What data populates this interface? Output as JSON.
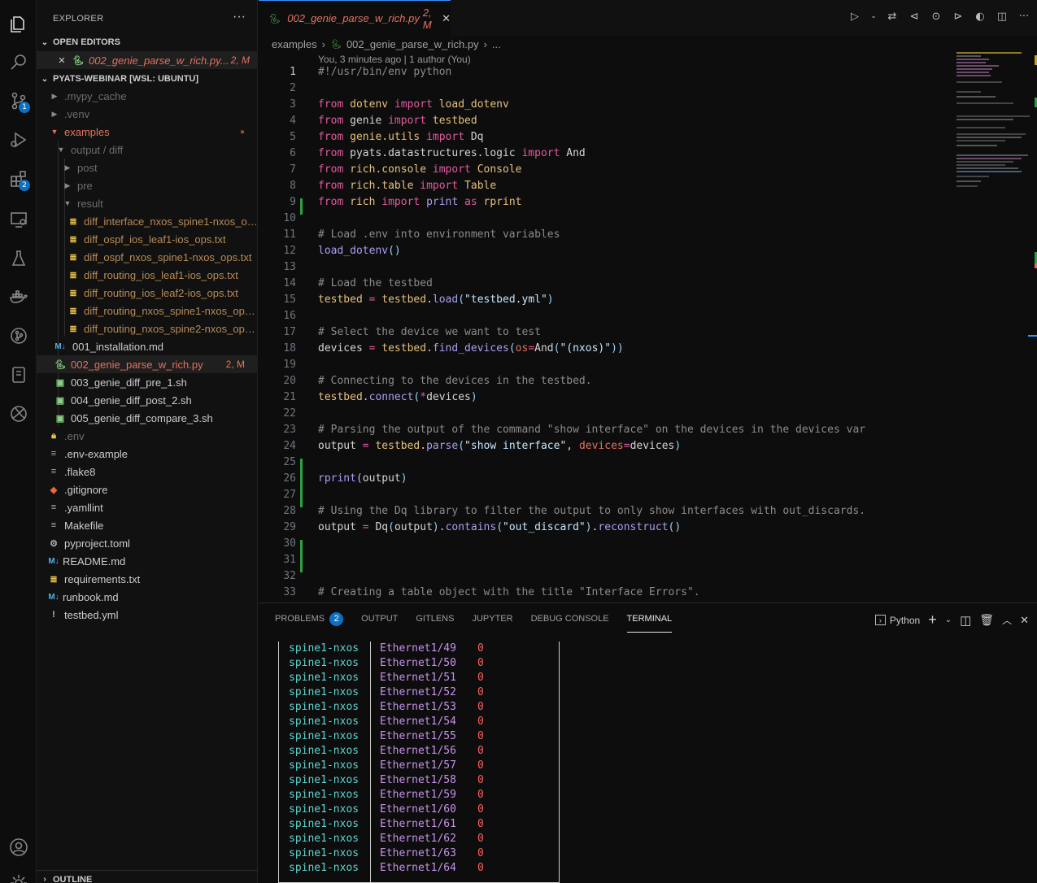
{
  "activity_bar": [
    {
      "icon": "files-icon",
      "badge": ""
    },
    {
      "icon": "search-icon",
      "badge": ""
    },
    {
      "icon": "source-control-icon",
      "badge": "1"
    },
    {
      "icon": "run-debug-icon",
      "badge": ""
    },
    {
      "icon": "extensions-icon",
      "badge": "2"
    },
    {
      "icon": "remote-explorer-icon",
      "badge": ""
    },
    {
      "icon": "testing-icon",
      "badge": ""
    },
    {
      "icon": "docker-icon",
      "badge": ""
    },
    {
      "icon": "gitlens-icon",
      "badge": ""
    },
    {
      "icon": "jupyter-icon",
      "badge": ""
    },
    {
      "icon": "browser-icon",
      "badge": ""
    },
    {
      "icon": "accounts-icon",
      "badge": ""
    },
    {
      "icon": "manage-gear-icon",
      "badge": ""
    }
  ],
  "sidebar": {
    "title": "EXPLORER",
    "more": "···",
    "open_editors_label": "OPEN EDITORS",
    "open_editor": {
      "name": "002_genie_parse_w_rich.py...",
      "status": "2, M"
    },
    "workspace_label": "PYATS-WEBINAR [WSL: UBUNTU]",
    "tree": [
      {
        "name": ".mypy_cache",
        "status": ""
      },
      {
        "name": ".venv",
        "status": ""
      },
      {
        "name": "examples",
        "status": "●"
      },
      {
        "name": "output / diff",
        "status": ""
      },
      {
        "name": "post",
        "status": ""
      },
      {
        "name": "pre",
        "status": ""
      },
      {
        "name": "result",
        "status": ""
      },
      {
        "name": "diff_interface_nxos_spine1-nxos_op...",
        "status": ""
      },
      {
        "name": "diff_ospf_ios_leaf1-ios_ops.txt",
        "status": ""
      },
      {
        "name": "diff_ospf_nxos_spine1-nxos_ops.txt",
        "status": ""
      },
      {
        "name": "diff_routing_ios_leaf1-ios_ops.txt",
        "status": ""
      },
      {
        "name": "diff_routing_ios_leaf2-ios_ops.txt",
        "status": ""
      },
      {
        "name": "diff_routing_nxos_spine1-nxos_ops...",
        "status": ""
      },
      {
        "name": "diff_routing_nxos_spine2-nxos_ops...",
        "status": ""
      },
      {
        "name": "001_installation.md",
        "status": ""
      },
      {
        "name": "002_genie_parse_w_rich.py",
        "status": "2, M"
      },
      {
        "name": "003_genie_diff_pre_1.sh",
        "status": ""
      },
      {
        "name": "004_genie_diff_post_2.sh",
        "status": ""
      },
      {
        "name": "005_genie_diff_compare_3.sh",
        "status": ""
      },
      {
        "name": ".env",
        "status": ""
      },
      {
        "name": ".env-example",
        "status": ""
      },
      {
        "name": ".flake8",
        "status": ""
      },
      {
        "name": ".gitignore",
        "status": ""
      },
      {
        "name": ".yamllint",
        "status": ""
      },
      {
        "name": "Makefile",
        "status": ""
      },
      {
        "name": "pyproject.toml",
        "status": ""
      },
      {
        "name": "README.md",
        "status": ""
      },
      {
        "name": "requirements.txt",
        "status": ""
      },
      {
        "name": "runbook.md",
        "status": ""
      },
      {
        "name": "testbed.yml",
        "status": ""
      }
    ],
    "outline_label": "OUTLINE"
  },
  "editor": {
    "tab_name": "002_genie_parse_w_rich.py",
    "tab_status": "2, M",
    "breadcrumb": [
      "examples",
      "002_genie_parse_w_rich.py",
      "..."
    ],
    "blame": "You, 3 minutes ago | 1 author (You)",
    "line_numbers": [
      "1",
      "2",
      "3",
      "4",
      "5",
      "6",
      "7",
      "8",
      "9",
      "10",
      "11",
      "12",
      "13",
      "14",
      "15",
      "16",
      "17",
      "18",
      "19",
      "20",
      "21",
      "22",
      "23",
      "24",
      "25",
      "26",
      "27",
      "28",
      "29",
      "30",
      "31",
      "32",
      "33"
    ]
  },
  "panel": {
    "tabs": [
      "PROBLEMS",
      "OUTPUT",
      "GITLENS",
      "JUPYTER",
      "DEBUG CONSOLE",
      "TERMINAL"
    ],
    "problems_count": "2",
    "active_tab": "TERMINAL",
    "terminal_profile": "Python",
    "terminal_rows": [
      {
        "device": "spine1-nxos",
        "interface": "Ethernet1/49",
        "value": "0"
      },
      {
        "device": "spine1-nxos",
        "interface": "Ethernet1/50",
        "value": "0"
      },
      {
        "device": "spine1-nxos",
        "interface": "Ethernet1/51",
        "value": "0"
      },
      {
        "device": "spine1-nxos",
        "interface": "Ethernet1/52",
        "value": "0"
      },
      {
        "device": "spine1-nxos",
        "interface": "Ethernet1/53",
        "value": "0"
      },
      {
        "device": "spine1-nxos",
        "interface": "Ethernet1/54",
        "value": "0"
      },
      {
        "device": "spine1-nxos",
        "interface": "Ethernet1/55",
        "value": "0"
      },
      {
        "device": "spine1-nxos",
        "interface": "Ethernet1/56",
        "value": "0"
      },
      {
        "device": "spine1-nxos",
        "interface": "Ethernet1/57",
        "value": "0"
      },
      {
        "device": "spine1-nxos",
        "interface": "Ethernet1/58",
        "value": "0"
      },
      {
        "device": "spine1-nxos",
        "interface": "Ethernet1/59",
        "value": "0"
      },
      {
        "device": "spine1-nxos",
        "interface": "Ethernet1/60",
        "value": "0"
      },
      {
        "device": "spine1-nxos",
        "interface": "Ethernet1/61",
        "value": "0"
      },
      {
        "device": "spine1-nxos",
        "interface": "Ethernet1/62",
        "value": "0"
      },
      {
        "device": "spine1-nxos",
        "interface": "Ethernet1/63",
        "value": "0"
      },
      {
        "device": "spine1-nxos",
        "interface": "Ethernet1/64",
        "value": "0"
      }
    ]
  },
  "colors": {
    "accent": "#3794ff",
    "modified": "#e2725f",
    "badge": "#0e70c0"
  }
}
